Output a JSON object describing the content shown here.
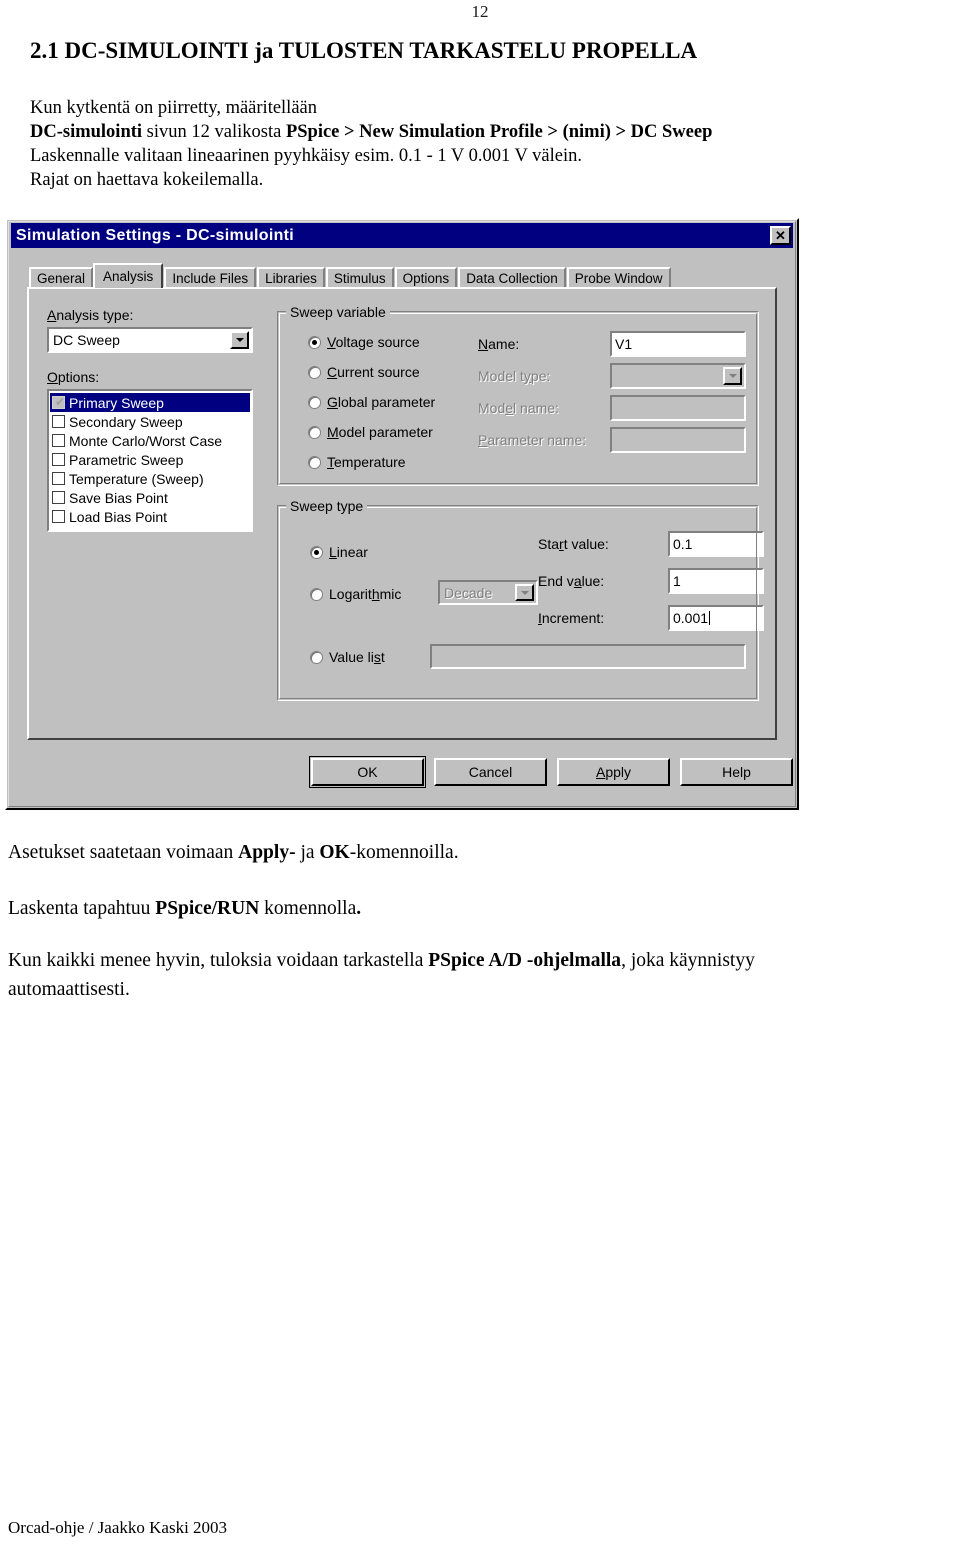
{
  "document": {
    "page_number": "12",
    "heading": "2.1  DC-SIMULOINTI ja TULOSTEN TARKASTELU PROPELLA",
    "intro_line1": "Kun kytkentä on piirretty,  määritellään",
    "intro_line2_bold1": "DC-simulointi",
    "intro_line2_plain1": " sivun 12 valikosta ",
    "intro_line2_bold2": "PSpice > New Simulation Profile > (nimi) >  DC Sweep",
    "intro_line3": "Laskennalle valitaan lineaarinen pyyhkäisy esim. 0.1 - 1 V  0.001 V välein.",
    "intro_line4": "Rajat on  haettava kokeilemalla.",
    "after_line1_a": "Asetukset saatetaan voimaan ",
    "after_line1_b": "Apply-",
    "after_line1_c": " ja ",
    "after_line1_d": "OK",
    "after_line1_e": "-komennoilla.",
    "after_line2_a": "Laskenta tapahtuu ",
    "after_line2_b": "PSpice/RUN",
    "after_line2_c": " komennolla",
    "after_line2_d": ".",
    "after_line3_a": "Kun kaikki menee hyvin, tuloksia voidaan tarkastella  ",
    "after_line3_b": "PSpice A/D -ohjelmalla",
    "after_line3_c": ", joka käynnistyy",
    "after_line4": "automaattisesti.",
    "footer": "Orcad-ohje / Jaakko Kaski 2003"
  },
  "dialog": {
    "title": "Simulation Settings - DC-simulointi",
    "close_label": "✕",
    "tabs": [
      {
        "label": "General",
        "active": false
      },
      {
        "label": "Analysis",
        "active": true
      },
      {
        "label": "Include Files",
        "active": false
      },
      {
        "label": "Libraries",
        "active": false
      },
      {
        "label": "Stimulus",
        "active": false
      },
      {
        "label": "Options",
        "active": false
      },
      {
        "label": "Data Collection",
        "active": false
      },
      {
        "label": "Probe Window",
        "active": false
      }
    ],
    "analysis_type": {
      "label_pre": "A",
      "label_post": "nalysis type:",
      "value": "DC Sweep"
    },
    "options": {
      "label_pre": "O",
      "label_post": "ptions:",
      "items": [
        {
          "label": "Primary Sweep",
          "checked": true,
          "selected": true
        },
        {
          "label": "Secondary Sweep",
          "checked": false,
          "selected": false
        },
        {
          "label": "Monte Carlo/Worst Case",
          "checked": false,
          "selected": false
        },
        {
          "label": "Parametric Sweep",
          "checked": false,
          "selected": false
        },
        {
          "label": "Temperature (Sweep)",
          "checked": false,
          "selected": false
        },
        {
          "label": "Save Bias Point",
          "checked": false,
          "selected": false
        },
        {
          "label": "Load Bias Point",
          "checked": false,
          "selected": false
        }
      ]
    },
    "sweep_variable": {
      "title": "Sweep variable",
      "radios": [
        {
          "pre": "",
          "key": "V",
          "post": "oltage source",
          "checked": true
        },
        {
          "pre": "",
          "key": "C",
          "post": "urrent source",
          "checked": false
        },
        {
          "pre": "",
          "key": "G",
          "post": "lobal parameter",
          "checked": false
        },
        {
          "pre": "",
          "key": "M",
          "post": "odel parameter",
          "checked": false
        },
        {
          "pre": "",
          "key": "T",
          "post": "emperature",
          "checked": false
        }
      ],
      "name_label_pre": "N",
      "name_label_post": "ame:",
      "name_value": "V1",
      "model_type_label_pre": "Model t",
      "model_type_label_key": "y",
      "model_type_label_post": "pe:",
      "model_type_value": "",
      "model_name_label_pre": "Mod",
      "model_name_label_key": "e",
      "model_name_label_post": "l name:",
      "model_name_value": "",
      "parameter_name_label_pre": "",
      "parameter_name_label_key": "P",
      "parameter_name_label_post": "arameter name:",
      "parameter_name_value": ""
    },
    "sweep_type": {
      "title": "Sweep type",
      "linear_pre": "",
      "linear_key": "L",
      "linear_post": "inear",
      "linear_checked": true,
      "log_pre": "Logarit",
      "log_key": "h",
      "log_post": "mic",
      "log_checked": false,
      "log_combo_value": "Decade",
      "value_list_pre": "Value li",
      "value_list_key": "s",
      "value_list_post": "t",
      "value_list_checked": false,
      "value_list_value": "",
      "start_label_pre": "Sta",
      "start_label_key": "r",
      "start_label_post": "t value:",
      "start_value": "0.1",
      "end_label_pre": "End v",
      "end_label_key": "a",
      "end_label_post": "lue:",
      "end_value": "1",
      "increment_label_pre": "",
      "increment_label_key": "I",
      "increment_label_post": "ncrement:",
      "increment_value": "0.001"
    },
    "buttons": [
      {
        "label": "OK",
        "default": true,
        "accel": ""
      },
      {
        "label": "Cancel",
        "default": false,
        "accel": ""
      },
      {
        "label": "Apply",
        "default": false,
        "accel": "A"
      },
      {
        "label": "Help",
        "default": false,
        "accel": ""
      }
    ]
  }
}
